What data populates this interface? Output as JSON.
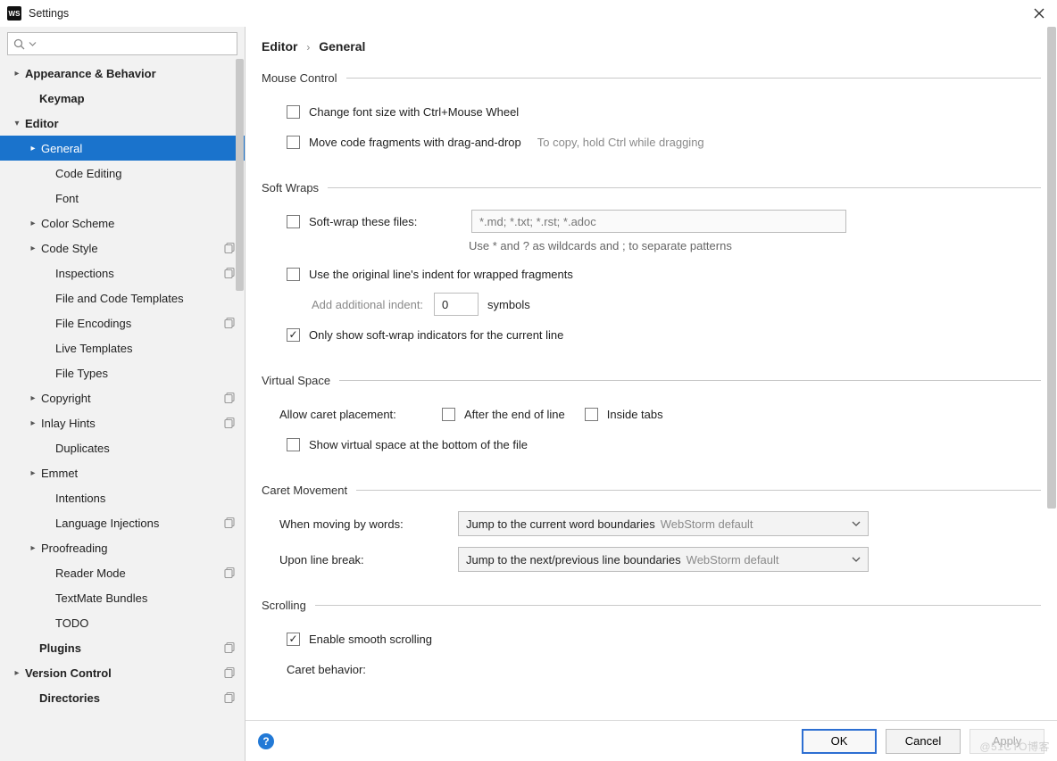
{
  "window": {
    "title": "Settings",
    "app_icon_text": "WS"
  },
  "sidebar": {
    "items": [
      {
        "label": "Appearance & Behavior",
        "indent": 12,
        "arrow": "right",
        "bold": true
      },
      {
        "label": "Keymap",
        "indent": 28,
        "arrow": "none",
        "bold": true
      },
      {
        "label": "Editor",
        "indent": 12,
        "arrow": "down",
        "bold": true
      },
      {
        "label": "General",
        "indent": 30,
        "arrow": "right",
        "bold": false,
        "selected": true
      },
      {
        "label": "Code Editing",
        "indent": 46,
        "arrow": "none"
      },
      {
        "label": "Font",
        "indent": 46,
        "arrow": "none"
      },
      {
        "label": "Color Scheme",
        "indent": 30,
        "arrow": "right"
      },
      {
        "label": "Code Style",
        "indent": 30,
        "arrow": "right",
        "copy": true
      },
      {
        "label": "Inspections",
        "indent": 46,
        "arrow": "none",
        "copy": true
      },
      {
        "label": "File and Code Templates",
        "indent": 46,
        "arrow": "none"
      },
      {
        "label": "File Encodings",
        "indent": 46,
        "arrow": "none",
        "copy": true
      },
      {
        "label": "Live Templates",
        "indent": 46,
        "arrow": "none"
      },
      {
        "label": "File Types",
        "indent": 46,
        "arrow": "none"
      },
      {
        "label": "Copyright",
        "indent": 30,
        "arrow": "right",
        "copy": true
      },
      {
        "label": "Inlay Hints",
        "indent": 30,
        "arrow": "right",
        "copy": true
      },
      {
        "label": "Duplicates",
        "indent": 46,
        "arrow": "none"
      },
      {
        "label": "Emmet",
        "indent": 30,
        "arrow": "right"
      },
      {
        "label": "Intentions",
        "indent": 46,
        "arrow": "none"
      },
      {
        "label": "Language Injections",
        "indent": 46,
        "arrow": "none",
        "copy": true
      },
      {
        "label": "Proofreading",
        "indent": 30,
        "arrow": "right"
      },
      {
        "label": "Reader Mode",
        "indent": 46,
        "arrow": "none",
        "copy": true
      },
      {
        "label": "TextMate Bundles",
        "indent": 46,
        "arrow": "none"
      },
      {
        "label": "TODO",
        "indent": 46,
        "arrow": "none"
      },
      {
        "label": "Plugins",
        "indent": 28,
        "arrow": "none",
        "bold": true,
        "copy": true
      },
      {
        "label": "Version Control",
        "indent": 12,
        "arrow": "right",
        "bold": true,
        "copy": true
      },
      {
        "label": "Directories",
        "indent": 28,
        "arrow": "none",
        "bold": true,
        "copy": true
      }
    ]
  },
  "breadcrumb": {
    "parent": "Editor",
    "current": "General"
  },
  "groups": {
    "mouse": {
      "legend": "Mouse Control",
      "cb_font": "Change font size with Ctrl+Mouse Wheel",
      "cb_drag": "Move code fragments with drag-and-drop",
      "cb_drag_hint": "To copy, hold Ctrl while dragging"
    },
    "softwraps": {
      "legend": "Soft Wraps",
      "cb_softwrap": "Soft-wrap these files:",
      "input_placeholder": "*.md; *.txt; *.rst; *.adoc",
      "note": "Use * and ? as wildcards and ; to separate patterns",
      "cb_indent": "Use the original line's indent for wrapped fragments",
      "add_indent_label": "Add additional indent:",
      "add_indent_value": "0",
      "add_indent_unit": "symbols",
      "cb_indicators": "Only show soft-wrap indicators for the current line"
    },
    "virtual": {
      "legend": "Virtual Space",
      "lbl_caret": "Allow caret placement:",
      "cb_after": "After the end of line",
      "cb_inside": "Inside tabs",
      "cb_show": "Show virtual space at the bottom of the file"
    },
    "caret": {
      "legend": "Caret Movement",
      "lbl_words": "When moving by words:",
      "sel_words": "Jump to the current word boundaries",
      "sel_words_def": "WebStorm default",
      "lbl_break": "Upon line break:",
      "sel_break": "Jump to the next/previous line boundaries",
      "sel_break_def": "WebStorm default"
    },
    "scrolling": {
      "legend": "Scrolling",
      "cb_smooth": "Enable smooth scrolling",
      "lbl_caret_behavior": "Caret behavior:"
    }
  },
  "footer": {
    "ok": "OK",
    "cancel": "Cancel",
    "apply": "Apply"
  },
  "watermark": "@51CTO博客"
}
